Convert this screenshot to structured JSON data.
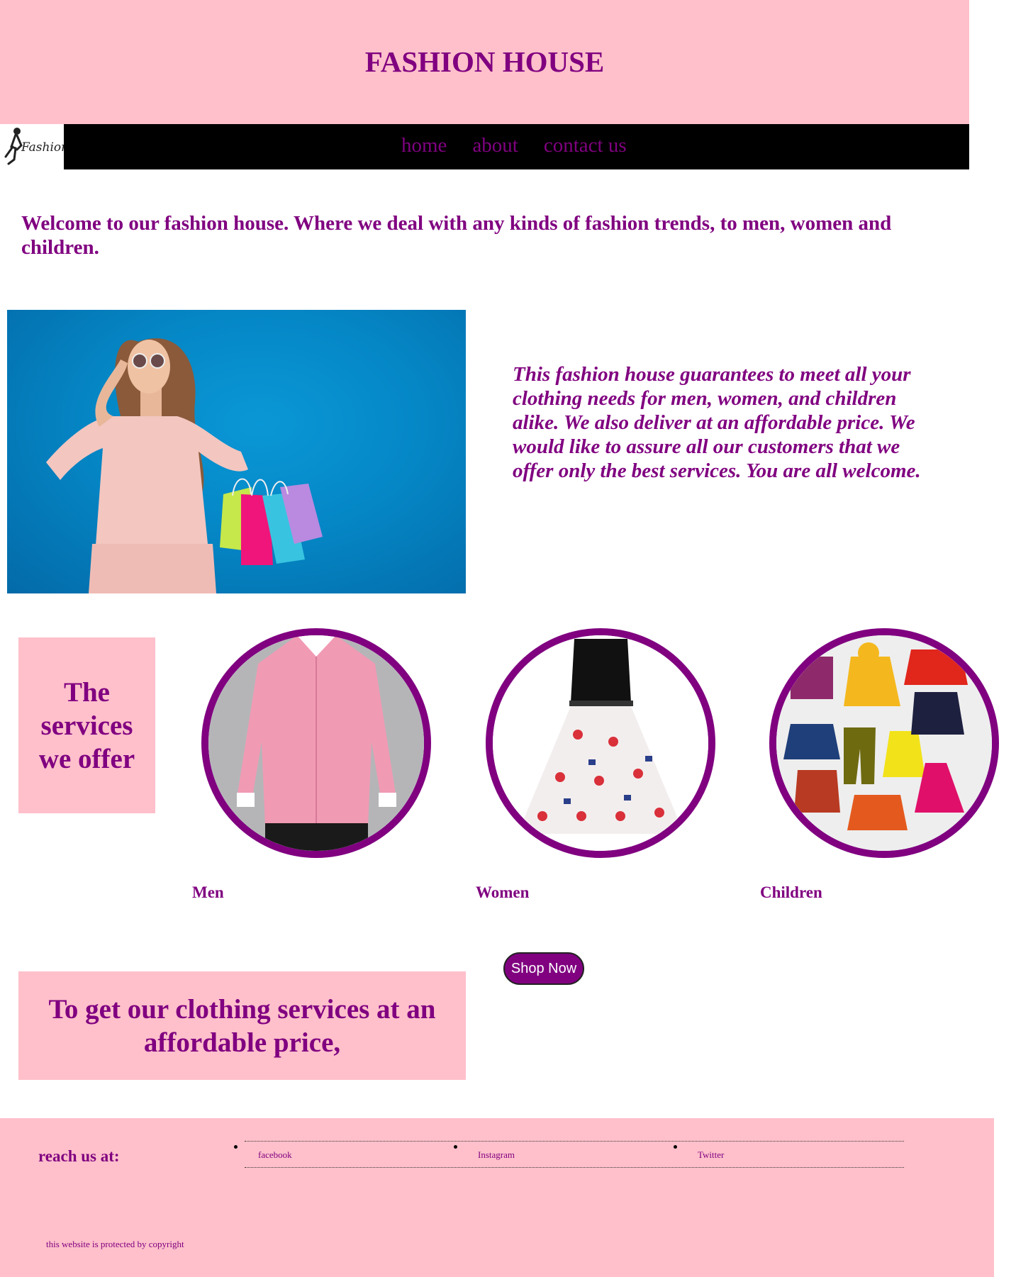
{
  "header": {
    "title": "FASHION HOUSE"
  },
  "logo": {
    "text": "Fashion"
  },
  "nav": {
    "items": [
      "home",
      "about",
      "contact us"
    ]
  },
  "welcome": "Welcome to our fashion house. Where we deal with any kinds of fashion trends, to men, women and children.",
  "intro": "This fashion house guarantees to meet all your clothing needs for men, women, and children alike. We also deliver at an affordable price. We would like to assure all our customers that we offer only the best services. You are all welcome.",
  "services": {
    "heading": "The services we offer",
    "categories": [
      {
        "label": "Men",
        "image": "pink-shirt-image"
      },
      {
        "label": "Women",
        "image": "dress-image"
      },
      {
        "label": "Children",
        "image": "kids-clothes-image"
      }
    ]
  },
  "shop_button": "Shop Now",
  "promo": "To get our clothing services at an affordable price,",
  "footer": {
    "reach_label": "reach us at:",
    "social": [
      "facebook",
      "Instagram",
      "Twitter"
    ],
    "copyright": "this website is protected by copyright"
  },
  "colors": {
    "primary": "#800080",
    "pink": "#ffc0cb",
    "nav_bg": "#000000",
    "hero_bg": "#0587c6"
  }
}
